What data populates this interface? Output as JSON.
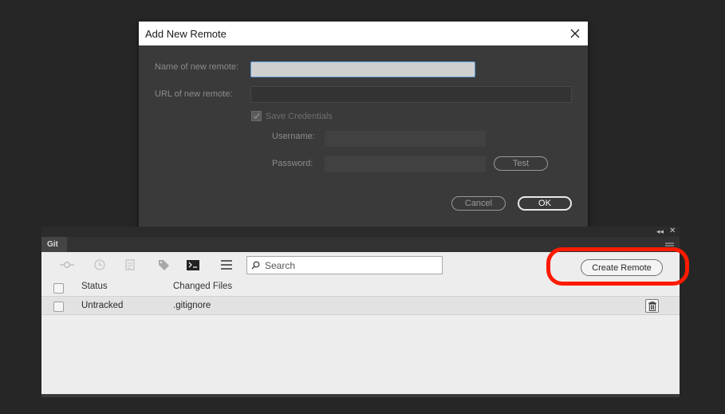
{
  "dialog": {
    "title": "Add New Remote",
    "name_label": "Name of new remote:",
    "name_value": "",
    "url_label": "URL of new remote:",
    "url_value": "",
    "save_credentials_label": "Save Credentials",
    "save_credentials_checked": true,
    "username_label": "Username:",
    "username_value": "",
    "password_label": "Password:",
    "password_value": "",
    "test_label": "Test",
    "cancel_label": "Cancel",
    "ok_label": "OK"
  },
  "panel": {
    "tab_label": "Git",
    "toolbar": {
      "icons": [
        "commit-icon",
        "history-icon",
        "stash-icon",
        "tag-icon",
        "terminal-icon",
        "menu-icon"
      ],
      "search_placeholder": "Search",
      "create_remote_label": "Create Remote"
    },
    "columns": [
      "Status",
      "Changed Files"
    ],
    "rows": [
      {
        "status": "Untracked",
        "file": ".gitignore"
      }
    ]
  },
  "colors": {
    "highlight": "#ff1a00",
    "background": "#262626",
    "dialog_bg": "#3a3a3a",
    "panel_bg": "#ededed"
  }
}
